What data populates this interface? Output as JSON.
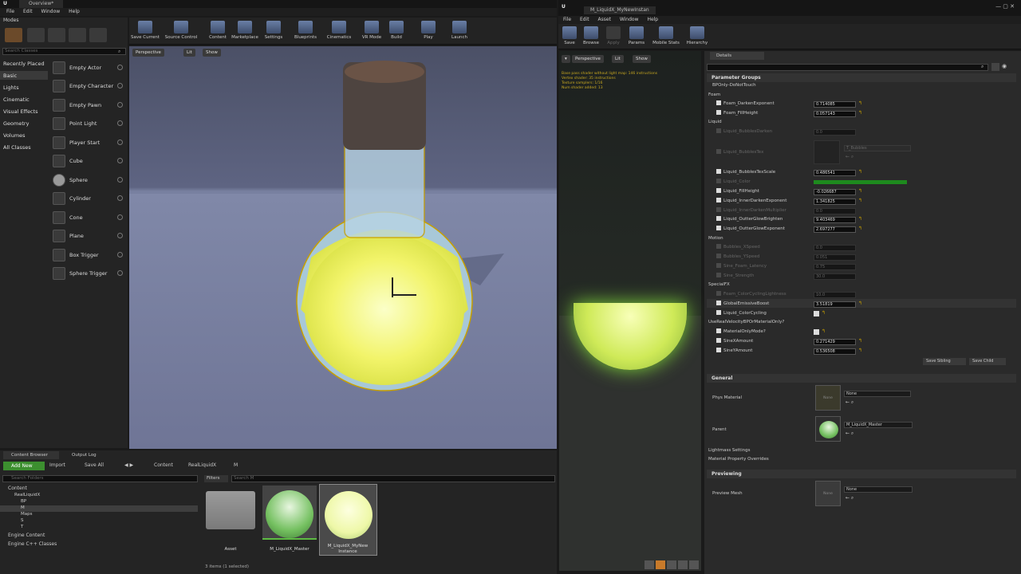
{
  "left": {
    "window_title": "Overview*",
    "menu": [
      "File",
      "Edit",
      "Window",
      "Help"
    ],
    "modes_label": "Modes",
    "search_classes_placeholder": "Search Classes",
    "categories": [
      "Recently Placed",
      "Basic",
      "Lights",
      "Cinematic",
      "Visual Effects",
      "Geometry",
      "Volumes",
      "All Classes"
    ],
    "classes": [
      "Empty Actor",
      "Empty Character",
      "Empty Pawn",
      "Point Light",
      "Player Start",
      "Cube",
      "Sphere",
      "Cylinder",
      "Cone",
      "Plane",
      "Box Trigger",
      "Sphere Trigger"
    ],
    "toolbar": [
      "Save Current",
      "Source Control",
      "Content",
      "Marketplace",
      "Settings",
      "Blueprints",
      "Cinematics",
      "VR Mode",
      "Build",
      "Play",
      "Launch"
    ],
    "viewport_buttons": [
      "Perspective",
      "Lit",
      "Show"
    ],
    "content_browser": {
      "tabs": [
        "Content Browser",
        "Output Log"
      ],
      "add_new": "Add New",
      "import": "Import",
      "save_all": "Save All",
      "path": [
        "Content",
        "RealLiquidX",
        "M"
      ],
      "search_folders_placeholder": "Search Folders",
      "filters_label": "Filters",
      "search_placeholder": "Search M",
      "tree": [
        "Content",
        "RealLiquidX",
        "BP",
        "M",
        "Maps",
        "S",
        "T",
        "Engine Content",
        "Engine C++ Classes"
      ],
      "assets": [
        {
          "line1": "Asset",
          "line2": ""
        },
        {
          "line1": "M_LiquidX_Master",
          "line2": ""
        },
        {
          "line1": "M_LiquidX_MyNew",
          "line2": "Instance"
        }
      ],
      "status": "3 items (1 selected)"
    }
  },
  "right": {
    "window_title": "M_LiquidX_MyNewInstan",
    "menu": [
      "File",
      "Edit",
      "Asset",
      "Window",
      "Help"
    ],
    "toolbar": [
      "Save",
      "Browse",
      "Apply",
      "Params",
      "Mobile Stats",
      "Hierarchy"
    ],
    "viewport_buttons": [
      "Perspective",
      "Lit",
      "Show"
    ],
    "stats": [
      "Base pass shader without light map: 146 instructions",
      "Vertex shader: 35 instructions",
      "Texture samplers: 1/16",
      "Num shader added: 13"
    ],
    "details_tab": "Details",
    "parameter_groups": "Parameter Groups",
    "bp_only": "BPOnly-DoNotTouch",
    "groups": [
      {
        "name": "Foam",
        "rows": [
          {
            "label": "Foam_DarkenExponent",
            "value": "0.714085",
            "on": true
          },
          {
            "label": "Foam_FillHeight",
            "value": "0.057143",
            "on": true
          }
        ]
      },
      {
        "name": "Liquid",
        "rows": [
          {
            "label": "Liquid_BubblesDarken",
            "value": "0.0",
            "on": false
          },
          {
            "label": "Liquid_BubblesTex",
            "value": "T_Bubbles",
            "on": false
          },
          {
            "label": "Liquid_BubblesTexScale",
            "value": "0.486541",
            "on": true
          },
          {
            "label": "Liquid_Color",
            "value": "",
            "on": false
          },
          {
            "label": "Liquid_FillHeight",
            "value": "-0.026687",
            "on": true
          },
          {
            "label": "Liquid_InnerDarkenExponent",
            "value": "1.341825",
            "on": true
          },
          {
            "label": "Liquid_InnerDarkenMultiplier",
            "value": "0.0",
            "on": false
          },
          {
            "label": "Liquid_OutterGlowBrighten",
            "value": "9.403469",
            "on": true
          },
          {
            "label": "Liquid_OutterGlowExponent",
            "value": "2.697277",
            "on": true
          }
        ]
      },
      {
        "name": "Motion",
        "rows": [
          {
            "label": "Bubbles_XSpeed",
            "value": "0.0",
            "on": false
          },
          {
            "label": "Bubbles_YSpeed",
            "value": "0.051",
            "on": false
          },
          {
            "label": "Sine_Foam_Latency",
            "value": "0.75",
            "on": false
          },
          {
            "label": "Sine_Strength",
            "value": "30.0",
            "on": false
          }
        ]
      },
      {
        "name": "SpecialFX",
        "rows": [
          {
            "label": "Foam_ColorCyclingLightness",
            "value": "10.0",
            "on": false
          },
          {
            "label": "GlobalEmissiveBoost",
            "value": "3.51819",
            "on": true
          },
          {
            "label": "Liquid_ColorCycling",
            "value": "",
            "on": true
          }
        ]
      },
      {
        "name": "UseRealVelocityBPOrMaterialOnly?",
        "rows": [
          {
            "label": "MaterialOnlyMode?",
            "value": "",
            "on": true
          },
          {
            "label": "SineXAmount",
            "value": "0.271429",
            "on": true
          },
          {
            "label": "SineYAmount",
            "value": "0.536508",
            "on": true
          }
        ]
      }
    ],
    "save_sibling": "Save Sibling",
    "save_child": "Save Child",
    "general": "General",
    "phys_material": "Phys Material",
    "none": "None",
    "parent": "Parent",
    "parent_value": "M_LiquidX_Master",
    "lightmass": "Lightmass Settings",
    "mat_prop": "Material Property Overrides",
    "previewing": "Previewing",
    "preview_mesh": "Preview Mesh",
    "liquid_color": "#1e8a1e"
  }
}
